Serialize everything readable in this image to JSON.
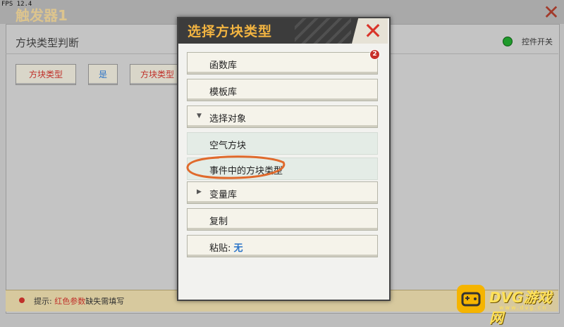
{
  "overlay": {
    "fps": "FPS 12.4"
  },
  "background": {
    "title": "触发器1",
    "close_glyph": "✕",
    "section_title": "方块类型判断",
    "switch_label": "控件开关",
    "condition_buttons": [
      "方块类型",
      "是",
      "方块类型"
    ],
    "hint": {
      "prefix": "提示: ",
      "red": "红色参数",
      "suffix": "缺失需填写"
    }
  },
  "modal": {
    "title": "选择方块类型",
    "close_glyph": "✕",
    "items": [
      {
        "label": "函数库",
        "badge": "2"
      },
      {
        "label": "模板库"
      },
      {
        "label": "选择对象",
        "arrow": "▼"
      },
      {
        "label": "空气方块"
      },
      {
        "label": "事件中的方块类型"
      },
      {
        "label": "变量库",
        "arrow": "▶"
      },
      {
        "label": "复制"
      },
      {
        "label": "粘贴: ",
        "value": "无"
      }
    ]
  },
  "watermark": {
    "name": "DVG游戏网",
    "url": "www.dvg.cn"
  },
  "colors": {
    "accent_title": "#f2b441",
    "close_red": "#d9352a",
    "paste_value": "#2a73c8",
    "annotation": "#e06a2c"
  }
}
